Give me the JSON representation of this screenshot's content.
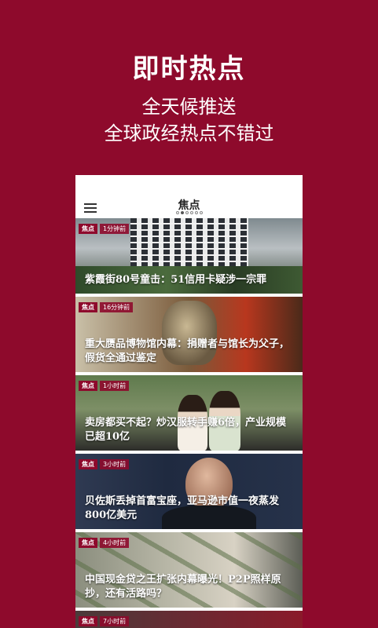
{
  "promo": {
    "title": "即时热点",
    "line1": "全天候推送",
    "line2": "全球政经热点不错过"
  },
  "app": {
    "title": "焦点",
    "menu_icon": "hamburger-menu-icon",
    "page_dots_count": 6,
    "active_dot": 1
  },
  "feed": [
    {
      "tag": "焦点",
      "time": "1分钟前",
      "headline": "紫霞街80号童击：51信用卡疑涉一宗罪"
    },
    {
      "tag": "焦点",
      "time": "16分钟前",
      "headline": "重大赝品博物馆内幕：捐赠者与馆长为父子，假货全通过鉴定"
    },
    {
      "tag": "焦点",
      "time": "1小时前",
      "headline": "卖房都买不起？炒汉服转手赚6倍，产业规模已超10亿"
    },
    {
      "tag": "焦点",
      "time": "3小时前",
      "headline": "贝佐斯丢掉首富宝座，亚马逊市值一夜蒸发800亿美元"
    },
    {
      "tag": "焦点",
      "time": "4小时前",
      "headline": "中国现金贷之王扩张内幕曝光！P2P照样原抄，还有活路吗？"
    },
    {
      "tag": "焦点",
      "time": "7小时前",
      "headline": ""
    }
  ],
  "colors": {
    "brand": "#8e0a2c"
  }
}
